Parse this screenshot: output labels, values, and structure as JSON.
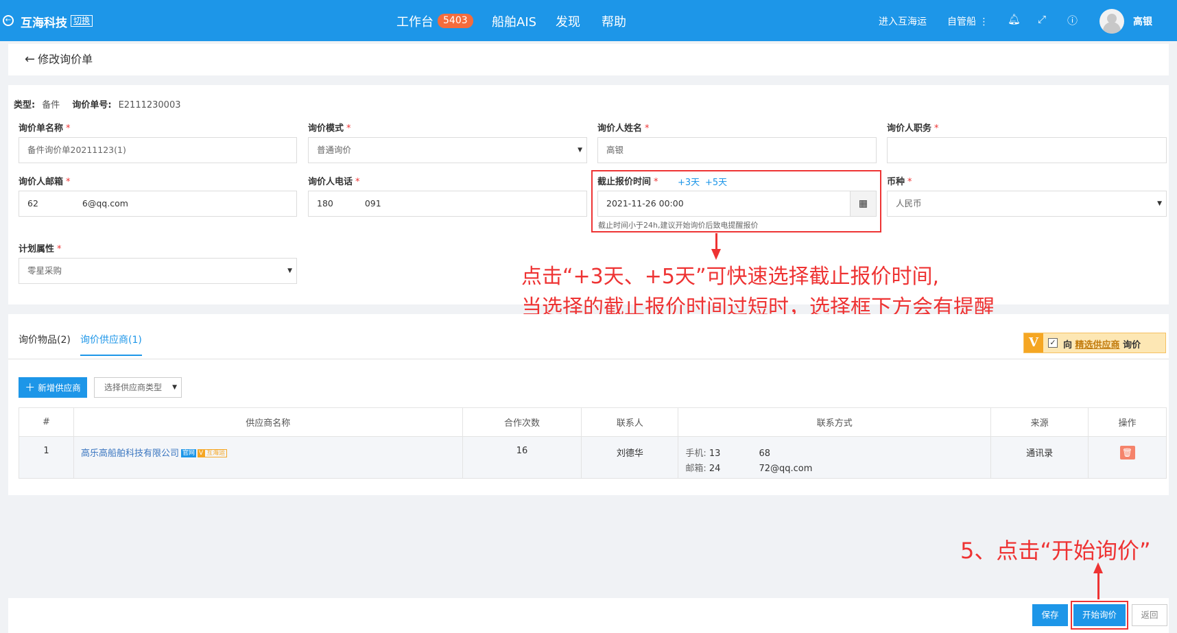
{
  "topbar": {
    "brand": "互海科技",
    "switch": "切换",
    "nav": [
      {
        "label": "工作台",
        "badge": "5403"
      },
      {
        "label": "船舶AIS"
      },
      {
        "label": "发现"
      },
      {
        "label": "帮助"
      }
    ],
    "enter_link": "进入互海运",
    "self_managed": "自管船",
    "user": "高银"
  },
  "page": {
    "title": "修改询价单"
  },
  "meta": {
    "type_label": "类型:",
    "type_value": "备件",
    "no_label": "询价单号:",
    "no_value": "E2111230003"
  },
  "form": {
    "name": {
      "label": "询价单名称",
      "value": "备件询价单20211123(1)"
    },
    "mode": {
      "label": "询价模式",
      "value": "普通询价"
    },
    "person": {
      "label": "询价人姓名",
      "value": "高银"
    },
    "duty": {
      "label": "询价人职务",
      "value": ""
    },
    "email": {
      "label": "询价人邮箱",
      "value_prefix": "62",
      "value_suffix": "6@qq.com"
    },
    "phone": {
      "label": "询价人电话",
      "value_prefix": "180",
      "value_suffix": "091"
    },
    "deadline": {
      "label": "截止报价时间",
      "quick3": "+3天",
      "quick5": "+5天",
      "value": "2021-11-26 00:00",
      "hint": "截止时间小于24h,建议开始询价后致电提醒报价"
    },
    "currency": {
      "label": "币种",
      "value": "人民币"
    },
    "plan": {
      "label": "计划属性",
      "value": "零星采购"
    }
  },
  "annotations": {
    "line1": "点击“+3天、+5天”可快速选择截止报价时间,",
    "line2": "当选择的截止报价时间过短时，选择框下方会有提醒",
    "step5": "5、点击“开始询价”"
  },
  "tabs": [
    {
      "label": "询价物品(2)"
    },
    {
      "label": "询价供应商(1)"
    }
  ],
  "premium": {
    "mark": "V",
    "text_before": "向",
    "text_link": "精选供应商",
    "text_after": "询价"
  },
  "supplier_toolbar": {
    "add_label": "新增供应商",
    "type_placeholder": "选择供应商类型"
  },
  "table": {
    "headers": [
      "#",
      "供应商名称",
      "合作次数",
      "联系人",
      "联系方式",
      "来源",
      "操作"
    ],
    "rows": [
      {
        "index": "1",
        "name": "高乐高船舶科技有限公司",
        "tag_gw": "官网",
        "tag_v": "V",
        "tag_hy": "互海运",
        "count": "16",
        "contact": "刘德华",
        "mobile_label": "手机:",
        "mobile_prefix": "13",
        "mobile_suffix": "68",
        "email_label": "邮箱:",
        "email_prefix": "24",
        "email_suffix": "72@qq.com",
        "source": "通讯录"
      }
    ]
  },
  "footer": {
    "save": "保存",
    "start": "开始询价",
    "back": "返回"
  },
  "colors": {
    "primary": "#1d96e8",
    "annotation_red": "#e33333",
    "badge": "#f56c3c"
  }
}
